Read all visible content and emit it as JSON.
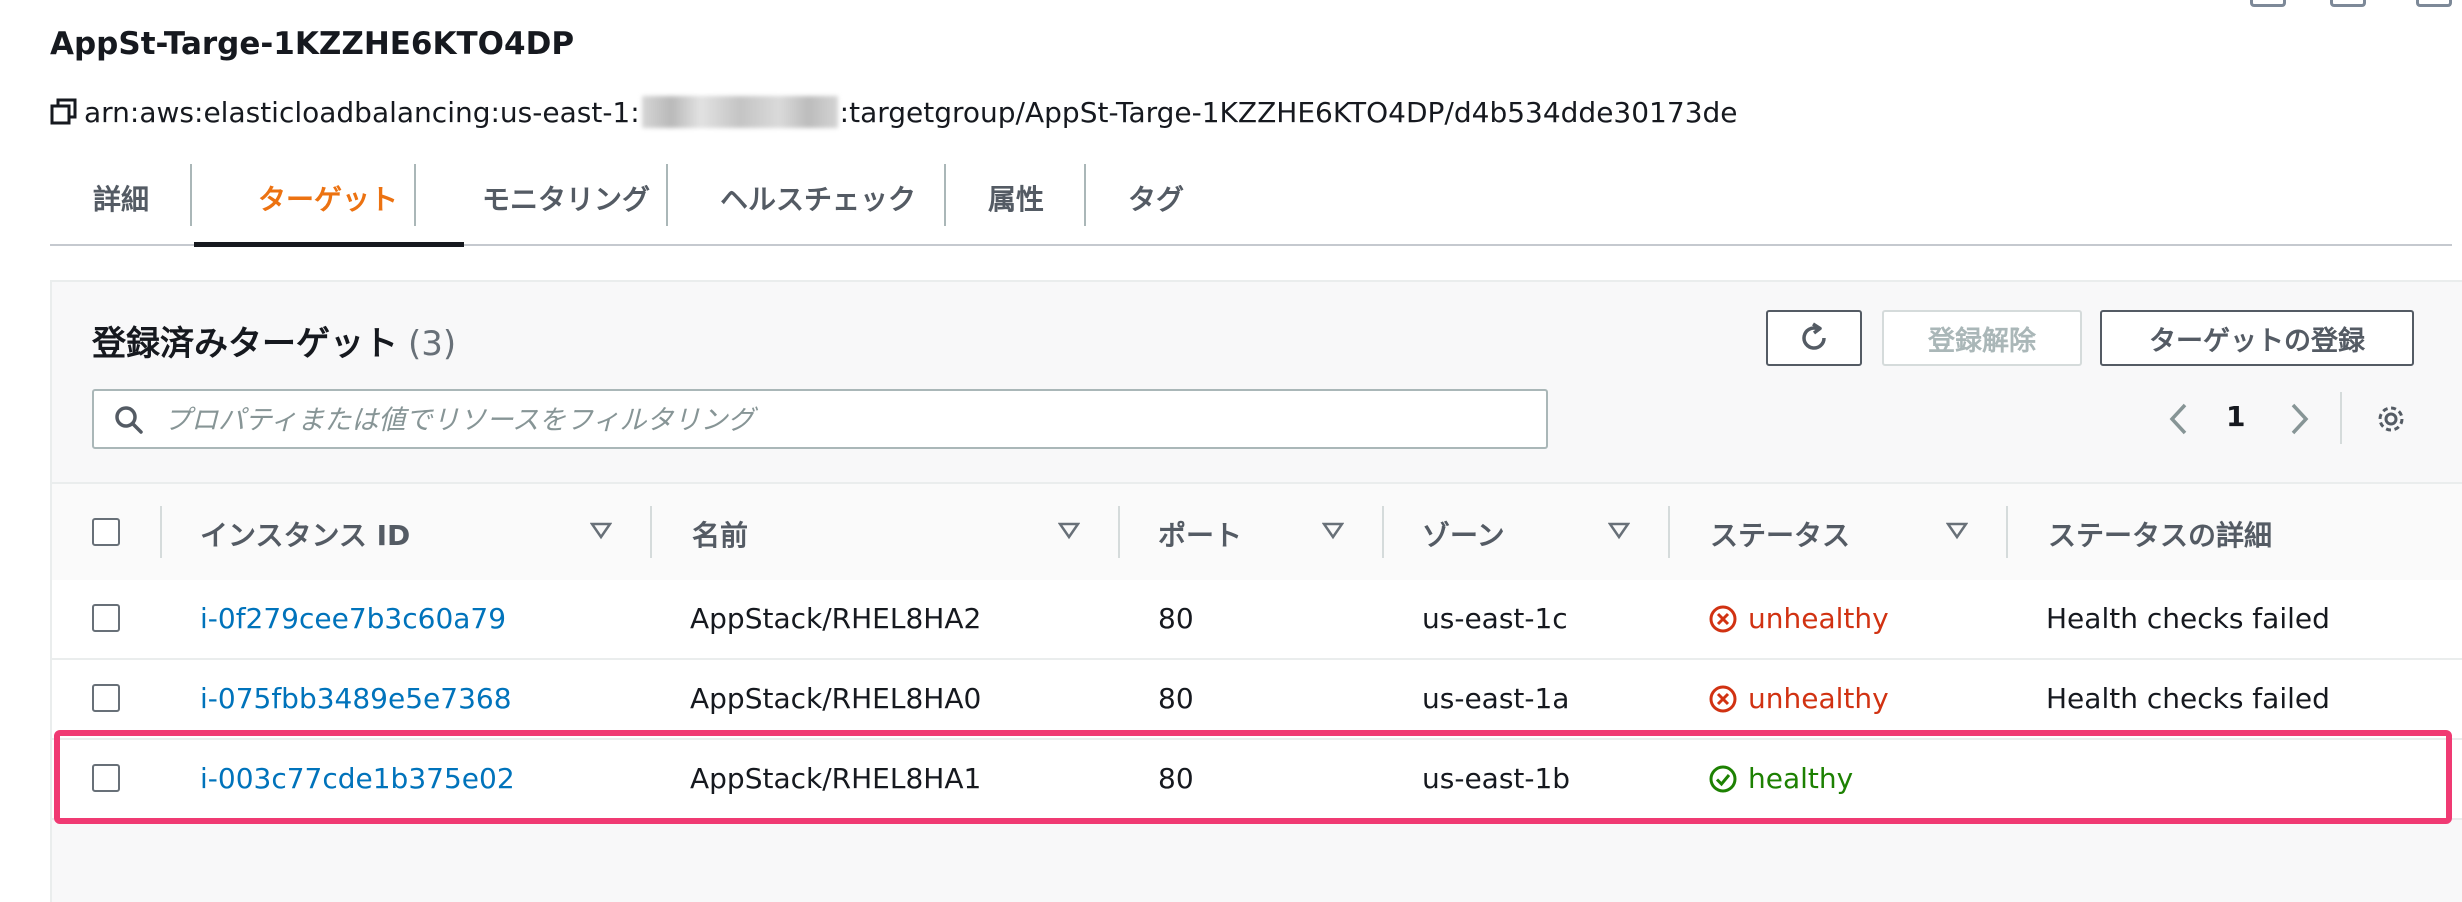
{
  "header": {
    "title": "AppSt-Targe-1KZZHE6KTO4DP",
    "arn_prefix": "arn:aws:elasticloadbalancing:us-east-1:",
    "arn_suffix": ":targetgroup/AppSt-Targe-1KZZHE6KTO4DP/d4b534dde30173de"
  },
  "tabs": [
    {
      "label": "詳細"
    },
    {
      "label": "ターゲット",
      "active": true
    },
    {
      "label": "モニタリング"
    },
    {
      "label": "ヘルスチェック"
    },
    {
      "label": "属性"
    },
    {
      "label": "タグ"
    }
  ],
  "panel": {
    "title": "登録済みターゲット",
    "count": "(3)",
    "deregister_label": "登録解除",
    "register_label": "ターゲットの登録",
    "search_placeholder": "プロパティまたは値でリソースをフィルタリング",
    "page": "1"
  },
  "table": {
    "columns": [
      "インスタンス ID",
      "名前",
      "ポート",
      "ゾーン",
      "ステータス",
      "ステータスの詳細"
    ],
    "rows": [
      {
        "id": "i-0f279cee7b3c60a79",
        "name": "AppStack/RHEL8HA2",
        "port": "80",
        "zone": "us-east-1c",
        "status": "unhealthy",
        "detail": "Health checks failed"
      },
      {
        "id": "i-075fbb3489e5e7368",
        "name": "AppStack/RHEL8HA0",
        "port": "80",
        "zone": "us-east-1a",
        "status": "unhealthy",
        "detail": "Health checks failed"
      },
      {
        "id": "i-003c77cde1b375e02",
        "name": "AppStack/RHEL8HA1",
        "port": "80",
        "zone": "us-east-1b",
        "status": "healthy",
        "detail": ""
      }
    ]
  },
  "colors": {
    "accent": "#ec7211",
    "link": "#0073bb",
    "unhealthy": "#d13212",
    "healthy": "#1d8102",
    "highlight": "#f03a73"
  }
}
